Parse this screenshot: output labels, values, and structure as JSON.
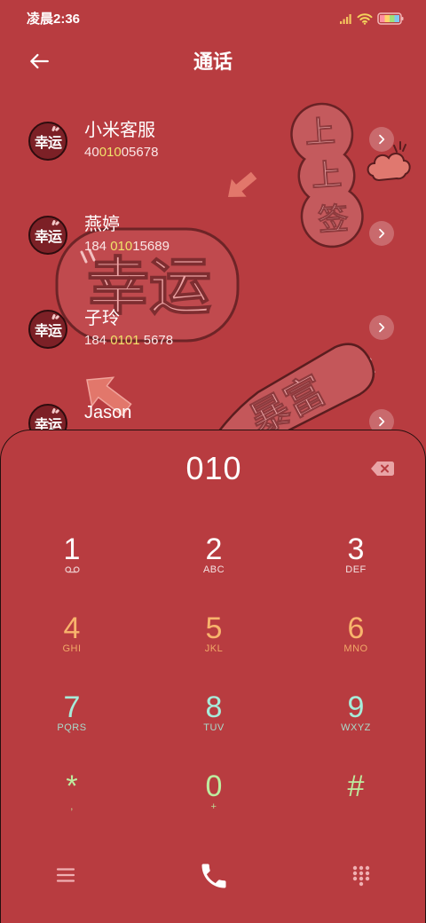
{
  "status_bar": {
    "time": "凌晨2:36",
    "icons": {
      "signal": "signal-icon",
      "wifi": "wifi-icon",
      "battery": "battery-icon"
    }
  },
  "header": {
    "title": "通话",
    "back_icon": "back-arrow-icon"
  },
  "contacts": [
    {
      "avatar_text": "幸运",
      "name": "小米客服",
      "number": {
        "pre": "40",
        "match": "010",
        "post": "05678"
      },
      "action_icon": "chevron-right-icon"
    },
    {
      "avatar_text": "幸运",
      "name": "燕婷",
      "number": {
        "pre": "184 ",
        "match": "010",
        "post": "15689"
      },
      "action_icon": "chevron-right-icon"
    },
    {
      "avatar_text": "幸运",
      "name": "子玲",
      "number": {
        "pre": "184 ",
        "match": "0101",
        "post": " 5678"
      },
      "action_icon": "chevron-right-icon"
    },
    {
      "avatar_text": "幸运",
      "name": "Jason",
      "action_icon": "chevron-right-icon"
    }
  ],
  "dialer": {
    "input": "010",
    "backspace_icon": "backspace-icon",
    "keys": [
      {
        "digit": "1",
        "sub_icon": "voicemail-icon"
      },
      {
        "digit": "2",
        "sub": "ABC"
      },
      {
        "digit": "3",
        "sub": "DEF"
      },
      {
        "digit": "4",
        "sub": "GHI"
      },
      {
        "digit": "5",
        "sub": "JKL"
      },
      {
        "digit": "6",
        "sub": "MNO"
      },
      {
        "digit": "7",
        "sub": "PQRS"
      },
      {
        "digit": "8",
        "sub": "TUV"
      },
      {
        "digit": "9",
        "sub": "WXYZ"
      },
      {
        "digit": "*",
        "sub": ","
      },
      {
        "digit": "0",
        "sub": "+"
      },
      {
        "digit": "#"
      }
    ]
  },
  "bottom_bar": {
    "menu_icon": "menu-icon",
    "call_icon": "phone-call-icon",
    "keypad_icon": "keypad-toggle-icon"
  },
  "wallpaper": {
    "sign_sticker": [
      "上",
      "上",
      "签"
    ],
    "lucky_stamp": "幸运",
    "carrot_sticker": "暴富"
  },
  "colors": {
    "background": "#b83c40",
    "number_highlight": "#f0e26a",
    "key_rows": [
      "#ffffff",
      "#f8b46c",
      "#a6ecda",
      "#bdec9f"
    ],
    "icon_muted": "#f0b0b2"
  }
}
